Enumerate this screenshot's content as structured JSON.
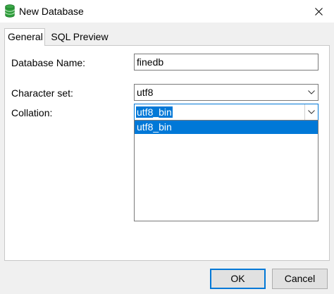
{
  "window": {
    "title": "New Database",
    "icon": "database-icon",
    "close_icon": "close-icon"
  },
  "tabs": [
    {
      "label": "General",
      "active": true
    },
    {
      "label": "SQL Preview",
      "active": false
    }
  ],
  "form": {
    "database_name": {
      "label": "Database Name:",
      "value": "finedb"
    },
    "character_set": {
      "label": "Character set:",
      "value": "utf8"
    },
    "collation": {
      "label": "Collation:",
      "value": "utf8_bin",
      "open": true,
      "options": [
        "utf8_bin"
      ]
    }
  },
  "buttons": {
    "ok": "OK",
    "cancel": "Cancel"
  },
  "colors": {
    "accent": "#0078d7",
    "icon_green": "#2e9d3a"
  }
}
